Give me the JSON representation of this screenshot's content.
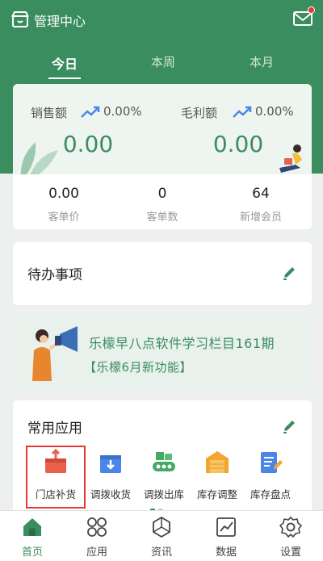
{
  "header": {
    "title": "管理中心",
    "store_icon": "store-icon",
    "mail_icon": "mail-icon",
    "has_notification": true
  },
  "tabs": [
    {
      "label": "今日",
      "active": true
    },
    {
      "label": "本周",
      "active": false
    },
    {
      "label": "本月",
      "active": false
    }
  ],
  "stats": {
    "sales": {
      "label": "销售额",
      "change": "0.00%",
      "value": "0.00"
    },
    "profit": {
      "label": "毛利额",
      "change": "0.00%",
      "value": "0.00"
    },
    "metrics": [
      {
        "value": "0.00",
        "label": "客单价"
      },
      {
        "value": "0",
        "label": "客单数"
      },
      {
        "value": "64",
        "label": "新增会员"
      }
    ]
  },
  "todo": {
    "title": "待办事项",
    "edit_icon": "pencil-icon"
  },
  "banner": {
    "line1": "乐檬早八点软件学习栏目161期",
    "line2": "【乐檬6月新功能】"
  },
  "apps": {
    "title": "常用应用",
    "edit_icon": "pencil-icon",
    "items": [
      {
        "label": "门店补货",
        "icon": "restock-box-icon",
        "color": "#e8604c",
        "selected": true
      },
      {
        "label": "调拨收货",
        "icon": "receive-box-icon",
        "color": "#4a86e8",
        "selected": false
      },
      {
        "label": "调拨出库",
        "icon": "conveyor-icon",
        "color": "#43a963",
        "selected": false
      },
      {
        "label": "库存调整",
        "icon": "warehouse-icon",
        "color": "#f2a531",
        "selected": false
      },
      {
        "label": "库存盘点",
        "icon": "clipboard-edit-icon",
        "color": "#4a86e8",
        "selected": false
      }
    ]
  },
  "bottom_nav": [
    {
      "label": "首页",
      "icon": "home-icon",
      "active": true
    },
    {
      "label": "应用",
      "icon": "grid-icon",
      "active": false
    },
    {
      "label": "资讯",
      "icon": "news-icon",
      "active": false
    },
    {
      "label": "数据",
      "icon": "chart-icon",
      "active": false
    },
    {
      "label": "设置",
      "icon": "gear-icon",
      "active": false
    }
  ],
  "colors": {
    "brand_green": "#3a8d5f",
    "highlight_red": "#e53935"
  }
}
